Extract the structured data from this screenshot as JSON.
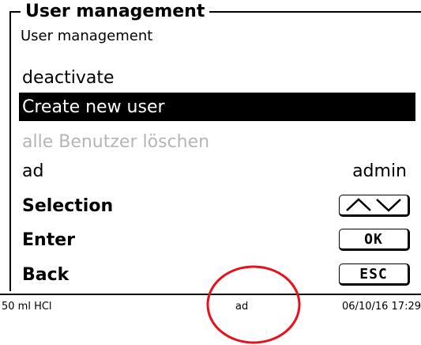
{
  "header": {
    "title": "User management",
    "subtitle": "User management"
  },
  "menu": {
    "items": [
      {
        "label": "deactivate",
        "value": "",
        "state": "normal"
      },
      {
        "label": "Create new user",
        "value": "",
        "state": "selected"
      },
      {
        "label": "alle Benutzer löschen",
        "value": "",
        "state": "disabled"
      },
      {
        "label": "ad",
        "value": "admin",
        "state": "normal"
      }
    ]
  },
  "keys": {
    "selection_label": "Selection",
    "selection_key_icon": "up-down-arrows-icon",
    "enter_label": "Enter",
    "enter_key": "OK",
    "back_label": "Back",
    "back_key": "ESC"
  },
  "status": {
    "left": "50 ml HCl",
    "center": "ad",
    "right": "06/10/16 17:29"
  },
  "annotation": {
    "icon": "red-circle-highlight",
    "color": "#e8101a"
  }
}
